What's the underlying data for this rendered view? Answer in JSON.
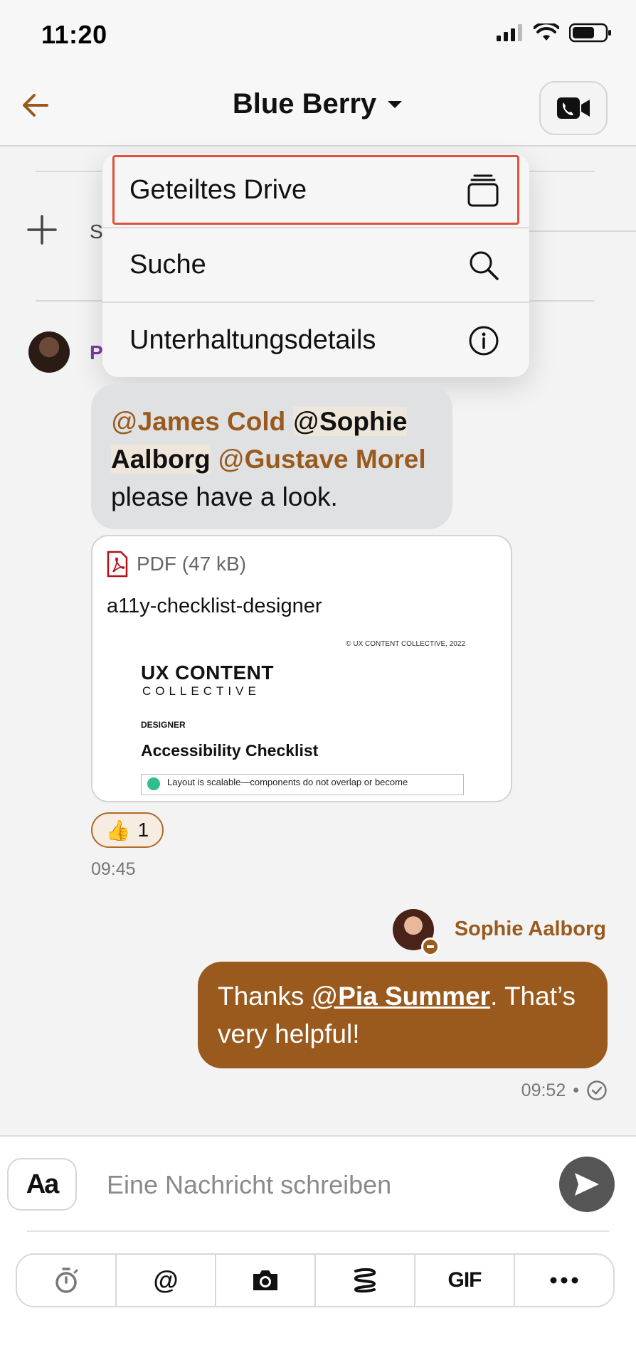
{
  "status_bar": {
    "time": "11:20"
  },
  "header": {
    "title": "Blue Berry"
  },
  "menu": {
    "items": [
      {
        "label": "Geteiltes Drive",
        "icon": "shared-drive-icon"
      },
      {
        "label": "Suche",
        "icon": "search-icon"
      },
      {
        "label": "Unterhaltungsdetails",
        "icon": "info-icon"
      }
    ]
  },
  "background": {
    "partial_s": "S",
    "partial_p": "P"
  },
  "message_in": {
    "mention1_at": "@",
    "mention1": "James Cold",
    "mention2_at": "@",
    "mention2": "Sophie Aalborg",
    "mention3_at": "@",
    "mention3": "Gustave Morel",
    "text": "please have a look."
  },
  "attachment": {
    "meta": "PDF (47 kB)",
    "name": "a11y-checklist-designer",
    "preview": {
      "copyright": "© UX CONTENT COLLECTIVE, 2022",
      "brand_line1": "UX CONTENT",
      "brand_line2": "COLLECTIVE",
      "role": "DESIGNER",
      "title": "Accessibility Checklist",
      "row1": "Layout is scalable—components do not overlap or become"
    }
  },
  "reaction": {
    "emoji": "👍",
    "count": "1"
  },
  "time_in": "09:45",
  "message_out": {
    "sender": "Sophie Aalborg",
    "prefix": "Thanks ",
    "mention_at": "@",
    "mention": "Pia Summer",
    "suffix": ". That’s very helpful!",
    "time": "09:52",
    "separator": "•"
  },
  "composer": {
    "format_label": "Aa",
    "placeholder": "Eine Nachricht schreiben",
    "tools": [
      "timer",
      "@",
      "camera",
      "giphy",
      "GIF",
      "more"
    ],
    "tool_at": "@",
    "tool_gif": "GIF"
  },
  "colors": {
    "accent": "#9a5a1e",
    "highlight": "#e0523c"
  }
}
